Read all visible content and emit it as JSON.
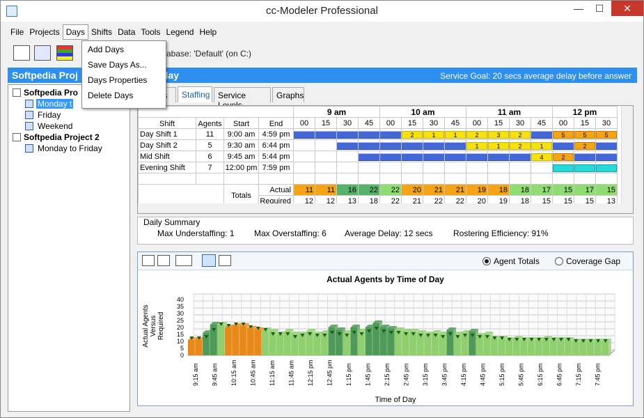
{
  "window": {
    "title": "cc-Modeler Professional",
    "min": "—",
    "max": "☐",
    "close": "✕"
  },
  "menu": [
    "File",
    "Projects",
    "Days",
    "Shifts",
    "Data",
    "Tools",
    "Legend",
    "Help"
  ],
  "days_menu": [
    "Add Days",
    "Save Days As...",
    "Days Properties",
    "Delete Days"
  ],
  "toolbar": {
    "db_text": "atabase: 'Default' (on C:)"
  },
  "banner": {
    "project": "Softpedia Proj",
    "day": "sday",
    "goal": "Service Goal: 20 secs average delay before answer"
  },
  "tree": {
    "p1": "Softpedia Pro",
    "p1_days": [
      "Monday t",
      "Friday",
      "Weekend"
    ],
    "p2": "Softpedia Project 2",
    "p2_days": [
      "Monday to Friday"
    ]
  },
  "tabs": [
    "lls",
    "Staffing",
    "Service Levels",
    "Graphs"
  ],
  "grid": {
    "headers": {
      "shift": "Shift",
      "agents": "Agents",
      "start": "Start",
      "end": "End",
      "totals": "Totals",
      "actual": "Actual",
      "required": "Required"
    },
    "hours": [
      "9 am",
      "10 am",
      "11 am",
      "12 pm"
    ],
    "minutes": [
      "00",
      "15",
      "30",
      "45",
      "00",
      "15",
      "30",
      "45",
      "00",
      "15",
      "30",
      "45",
      "00",
      "15",
      "30"
    ],
    "shifts": [
      {
        "name": "Day Shift 1",
        "agents": "11",
        "start": "9:00 am",
        "end": "4:59 pm"
      },
      {
        "name": "Day Shift 2",
        "agents": "5",
        "start": "9:30 am",
        "end": "6:44 pm"
      },
      {
        "name": "Mid Shift",
        "agents": "6",
        "start": "9:45 am",
        "end": "5:44 pm"
      },
      {
        "name": "Evening Shift",
        "agents": "7",
        "start": "12:00 pm",
        "end": "7:59 pm"
      }
    ],
    "break_labels": [
      [
        "",
        "",
        "",
        "",
        "",
        "2",
        "1",
        "1",
        "2",
        "3",
        "2",
        "",
        "5",
        "5",
        "5"
      ],
      [
        "",
        "",
        "",
        "",
        "",
        "",
        "",
        "",
        "1",
        "1",
        "2",
        "1",
        "",
        "2",
        ""
      ],
      [
        "",
        "",
        "",
        "",
        "",
        "",
        "",
        "",
        "",
        "",
        "",
        "4",
        "2",
        "",
        ""
      ],
      [
        "",
        "",
        "",
        "",
        "",
        "",
        "",
        "",
        "",
        "",
        "",
        "",
        "",
        "",
        ""
      ]
    ],
    "actual": [
      "11",
      "11",
      "16",
      "22",
      "22",
      "20",
      "21",
      "21",
      "19",
      "18",
      "18",
      "17",
      "15",
      "17",
      "15"
    ],
    "required": [
      "12",
      "12",
      "13",
      "18",
      "22",
      "21",
      "22",
      "22",
      "20",
      "19",
      "18",
      "15",
      "15",
      "15",
      "13"
    ]
  },
  "summary": {
    "label": "Daily Summary",
    "items": [
      "Max Understaffing: 1",
      "Max Overstaffing: 6",
      "Average Delay: 12 secs",
      "Rostering Efficiency: 91%"
    ]
  },
  "chart_toolbar": {
    "agent_totals": "Agent Totals",
    "coverage_gap": "Coverage Gap"
  },
  "chart_data": {
    "type": "bar",
    "title": "Actual Agents by Time of Day",
    "xlabel": "Time of Day",
    "ylabel": "Actual Agents Versus Required",
    "ylim": [
      0,
      40
    ],
    "yticks": [
      "40",
      "35",
      "30",
      "25",
      "20",
      "15",
      "10",
      "5",
      "0"
    ],
    "categories": [
      "9:15 am",
      "9:45 am",
      "10:15 am",
      "10:45 am",
      "11:15 am",
      "11:45 am",
      "12:15 pm",
      "12:45 pm",
      "1:15 pm",
      "1:45 pm",
      "2:15 pm",
      "2:45 pm",
      "3:15 pm",
      "3:45 pm",
      "4:15 pm",
      "4:45 pm",
      "5:15 pm",
      "5:45 pm",
      "6:15 pm",
      "6:45 pm",
      "7:15 pm",
      "7:45 pm"
    ],
    "series": [
      {
        "name": "Actual",
        "values": [
          11,
          11,
          16,
          22,
          22,
          20,
          21,
          21,
          19,
          18,
          18,
          17,
          15,
          17,
          15,
          15,
          17,
          15,
          16,
          20,
          18,
          16,
          20,
          17,
          20,
          23,
          20,
          19,
          18,
          17,
          17,
          16,
          15,
          16,
          15,
          18,
          15,
          16,
          17,
          14,
          15,
          12,
          12,
          11,
          12,
          11,
          11,
          11,
          12,
          11,
          11,
          11,
          10,
          10,
          10,
          10,
          10
        ]
      },
      {
        "name": "Required",
        "values": [
          12,
          12,
          13,
          18,
          22,
          21,
          22,
          22,
          20,
          19,
          18,
          15,
          15,
          15,
          13,
          14,
          15,
          14,
          14,
          16,
          15,
          14,
          16,
          15,
          17,
          19,
          17,
          16,
          16,
          15,
          15,
          14,
          14,
          14,
          13,
          15,
          13,
          14,
          14,
          13,
          13,
          12,
          12,
          11,
          11,
          11,
          11,
          11,
          11,
          11,
          11,
          11,
          10,
          10,
          10,
          10,
          10
        ]
      }
    ],
    "colors": {
      "under": "#e88a1a",
      "near": "#8fcf6e",
      "over": "#4e9a58",
      "required": "#1a5e1a"
    }
  }
}
